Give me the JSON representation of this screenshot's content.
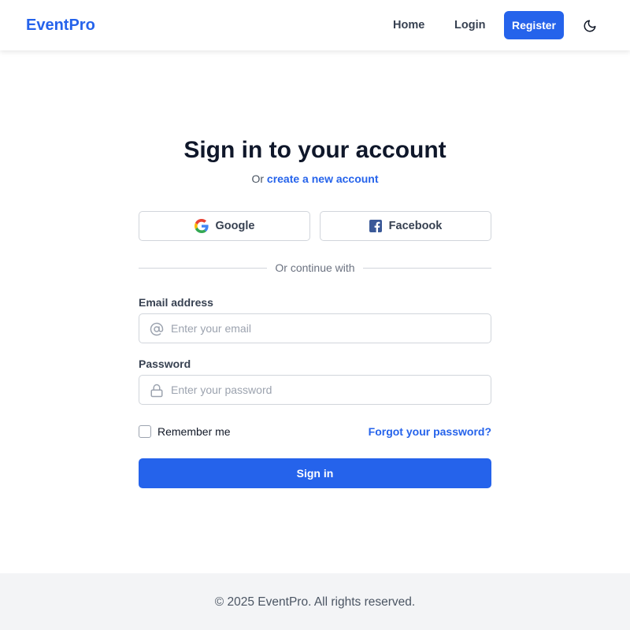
{
  "header": {
    "brand": "EventPro",
    "nav": {
      "home_label": "Home",
      "login_label": "Login",
      "register_label": "Register"
    },
    "theme_toggle_icon": "moon-icon"
  },
  "main": {
    "title": "Sign in to your account",
    "subtitle_prefix": "Or",
    "subtitle_link": "create a new account",
    "social": {
      "google_label": "Google",
      "google_icon": "google-icon",
      "facebook_label": "Facebook",
      "facebook_icon": "facebook-icon"
    },
    "divider_text": "Or continue with",
    "email": {
      "label": "Email address",
      "placeholder": "Enter your email",
      "value": "",
      "icon": "at-sign-icon"
    },
    "password": {
      "label": "Password",
      "placeholder": "Enter your password",
      "value": "",
      "icon": "lock-icon"
    },
    "remember_label": "Remember me",
    "remember_checked": false,
    "forgot_label": "Forgot your password?",
    "signin_label": "Sign in"
  },
  "footer": {
    "text": "© 2025 EventPro. All rights reserved."
  },
  "colors": {
    "accent": "#2563eb",
    "heading": "#0f172a",
    "footer_bg": "#f3f4f6",
    "facebook": "#3b5998"
  }
}
